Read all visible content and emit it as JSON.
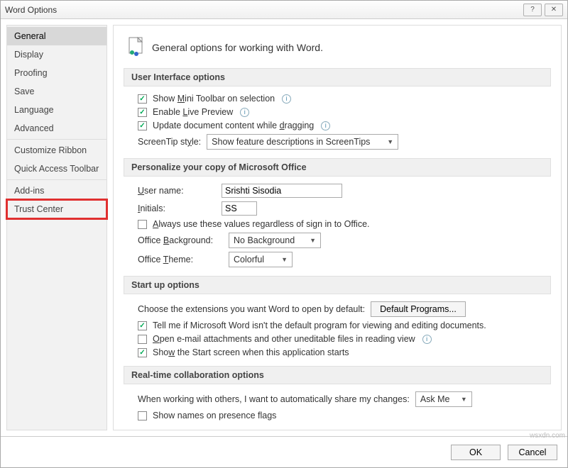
{
  "title": "Word Options",
  "sidebar": {
    "items": [
      {
        "label": "General"
      },
      {
        "label": "Display"
      },
      {
        "label": "Proofing"
      },
      {
        "label": "Save"
      },
      {
        "label": "Language"
      },
      {
        "label": "Advanced"
      },
      {
        "label": "Customize Ribbon"
      },
      {
        "label": "Quick Access Toolbar"
      },
      {
        "label": "Add-ins"
      },
      {
        "label": "Trust Center"
      }
    ]
  },
  "header_text": "General options for working with Word.",
  "sections": {
    "ui": {
      "title": "User Interface options",
      "show_mini_pre": "Show ",
      "show_mini_u": "M",
      "show_mini_post": "ini Toolbar on selection",
      "live_pre": "Enable ",
      "live_u": "L",
      "live_post": "ive Preview",
      "drag_pre": "Update document content while ",
      "drag_u": "d",
      "drag_post": "ragging",
      "screentip_label_pre": "ScreenTip st",
      "screentip_label_u": "y",
      "screentip_label_post": "le:",
      "screentip_value": "Show feature descriptions in ScreenTips"
    },
    "personalize": {
      "title": "Personalize your copy of Microsoft Office",
      "username_u": "U",
      "username_label": "ser name:",
      "username_value": "Srishti Sisodia",
      "initials_u": "I",
      "initials_label": "nitials:",
      "initials_value": "SS",
      "always_u": "A",
      "always_text": "lways use these values regardless of sign in to Office.",
      "bg_label_pre": "Office ",
      "bg_label_u": "B",
      "bg_label_post": "ackground:",
      "bg_value": "No Background",
      "theme_label_pre": "Office ",
      "theme_label_u": "T",
      "theme_label_post": "heme:",
      "theme_value": "Colorful"
    },
    "startup": {
      "title": "Start up options",
      "choose_text": "Choose the extensions you want Word to open by default:",
      "default_btn": "Default Programs...",
      "tell_text": "Tell me if Microsoft Word isn't the default program for viewing and editing documents.",
      "open_u": "O",
      "open_text": "pen e-mail attachments and other uneditable files in reading view",
      "show_start_pre": "Sho",
      "show_start_u": "w",
      "show_start_post": " the Start screen when this application starts"
    },
    "collab": {
      "title": "Real-time collaboration options",
      "share_text": "When working with others, I want to automatically share my changes:",
      "share_value": "Ask Me",
      "presence_text": "Show names on presence flags"
    }
  },
  "footer": {
    "ok": "OK",
    "cancel": "Cancel"
  },
  "watermark": "wsxdn.com"
}
